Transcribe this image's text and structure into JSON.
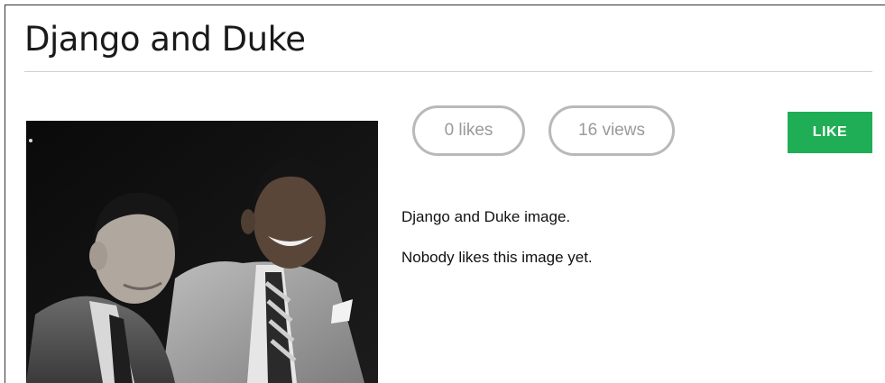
{
  "page": {
    "title": "Django and Duke"
  },
  "image": {
    "alt": "Django and Duke"
  },
  "stats": {
    "likes_label": "0 likes",
    "views_label": "16 views"
  },
  "actions": {
    "like_label": "LIKE",
    "like_color": "#1fae55"
  },
  "description": {
    "caption": "Django and Duke image.",
    "likers_text": "Nobody likes this image yet."
  }
}
